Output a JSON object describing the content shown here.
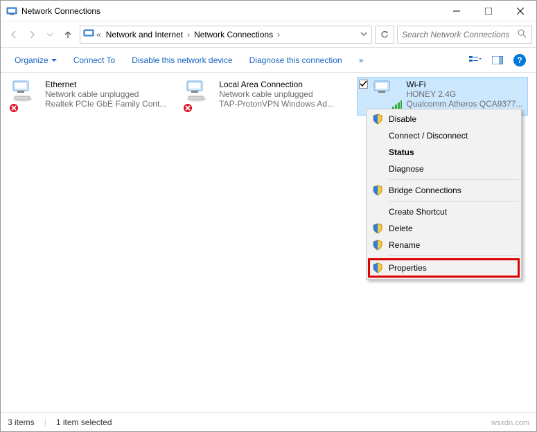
{
  "window": {
    "title": "Network Connections"
  },
  "breadcrumb": {
    "item1": "Network and Internet",
    "item2": "Network Connections"
  },
  "search": {
    "placeholder": "Search Network Connections"
  },
  "cmdbar": {
    "organize": "Organize",
    "connect": "Connect To",
    "disable": "Disable this network device",
    "diagnose": "Diagnose this connection"
  },
  "connections": [
    {
      "name": "Ethernet",
      "status": "Network cable unplugged",
      "device": "Realtek PCIe GbE Family Cont..."
    },
    {
      "name": "Local Area Connection",
      "status": "Network cable unplugged",
      "device": "TAP-ProtonVPN Windows Ad..."
    },
    {
      "name": "Wi-Fi",
      "status": "HONEY 2.4G",
      "device": "Qualcomm Atheros QCA9377..."
    }
  ],
  "context_menu": {
    "disable": "Disable",
    "connect": "Connect / Disconnect",
    "status": "Status",
    "diagnose": "Diagnose",
    "bridge": "Bridge Connections",
    "shortcut": "Create Shortcut",
    "delete": "Delete",
    "rename": "Rename",
    "properties": "Properties"
  },
  "statusbar": {
    "items": "3 items",
    "selected": "1 item selected"
  },
  "watermark": "wsxdn.com"
}
